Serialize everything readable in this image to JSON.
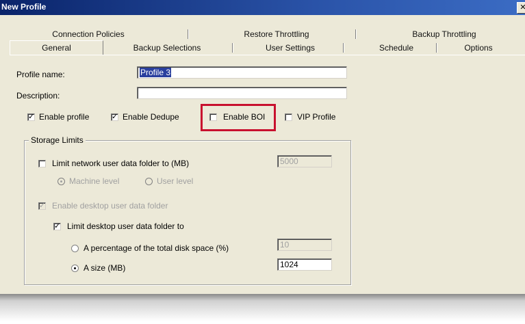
{
  "window": {
    "title": "New Profile",
    "close_glyph": "✕"
  },
  "tabs": {
    "back_row": [
      "Connection Policies",
      "Restore Throttling",
      "Backup Throttling"
    ],
    "front_row": [
      "General",
      "Backup Selections",
      "User Settings",
      "Schedule",
      "Options"
    ],
    "active": "General"
  },
  "form": {
    "profile_name_label": "Profile name:",
    "profile_name_value": "Profile 3",
    "description_label": "Description:",
    "description_value": "",
    "enable_profile_label": "Enable profile",
    "enable_profile_checked": true,
    "enable_dedupe_label": "Enable Dedupe",
    "enable_dedupe_checked": true,
    "enable_boi_label": "Enable BOI",
    "enable_boi_checked": false,
    "vip_profile_label": "VIP Profile",
    "vip_profile_checked": false
  },
  "storage": {
    "group_title": "Storage Limits",
    "limit_network_label": "Limit network user data folder to (MB)",
    "limit_network_checked": false,
    "limit_network_value": "5000",
    "machine_level_label": "Machine level",
    "user_level_label": "User level",
    "enable_desktop_label": "Enable desktop user data folder",
    "enable_desktop_checked": true,
    "limit_desktop_label": "Limit desktop user data folder to",
    "limit_desktop_checked": true,
    "percentage_label": "A percentage of the total disk space (%)",
    "percentage_value": "10",
    "size_label": "A size (MB)",
    "size_value": "1024",
    "size_selected": true
  },
  "colors": {
    "highlight": "#c8102e",
    "titlebar": "#0a246a",
    "dialog_bg": "#ece9d8"
  }
}
